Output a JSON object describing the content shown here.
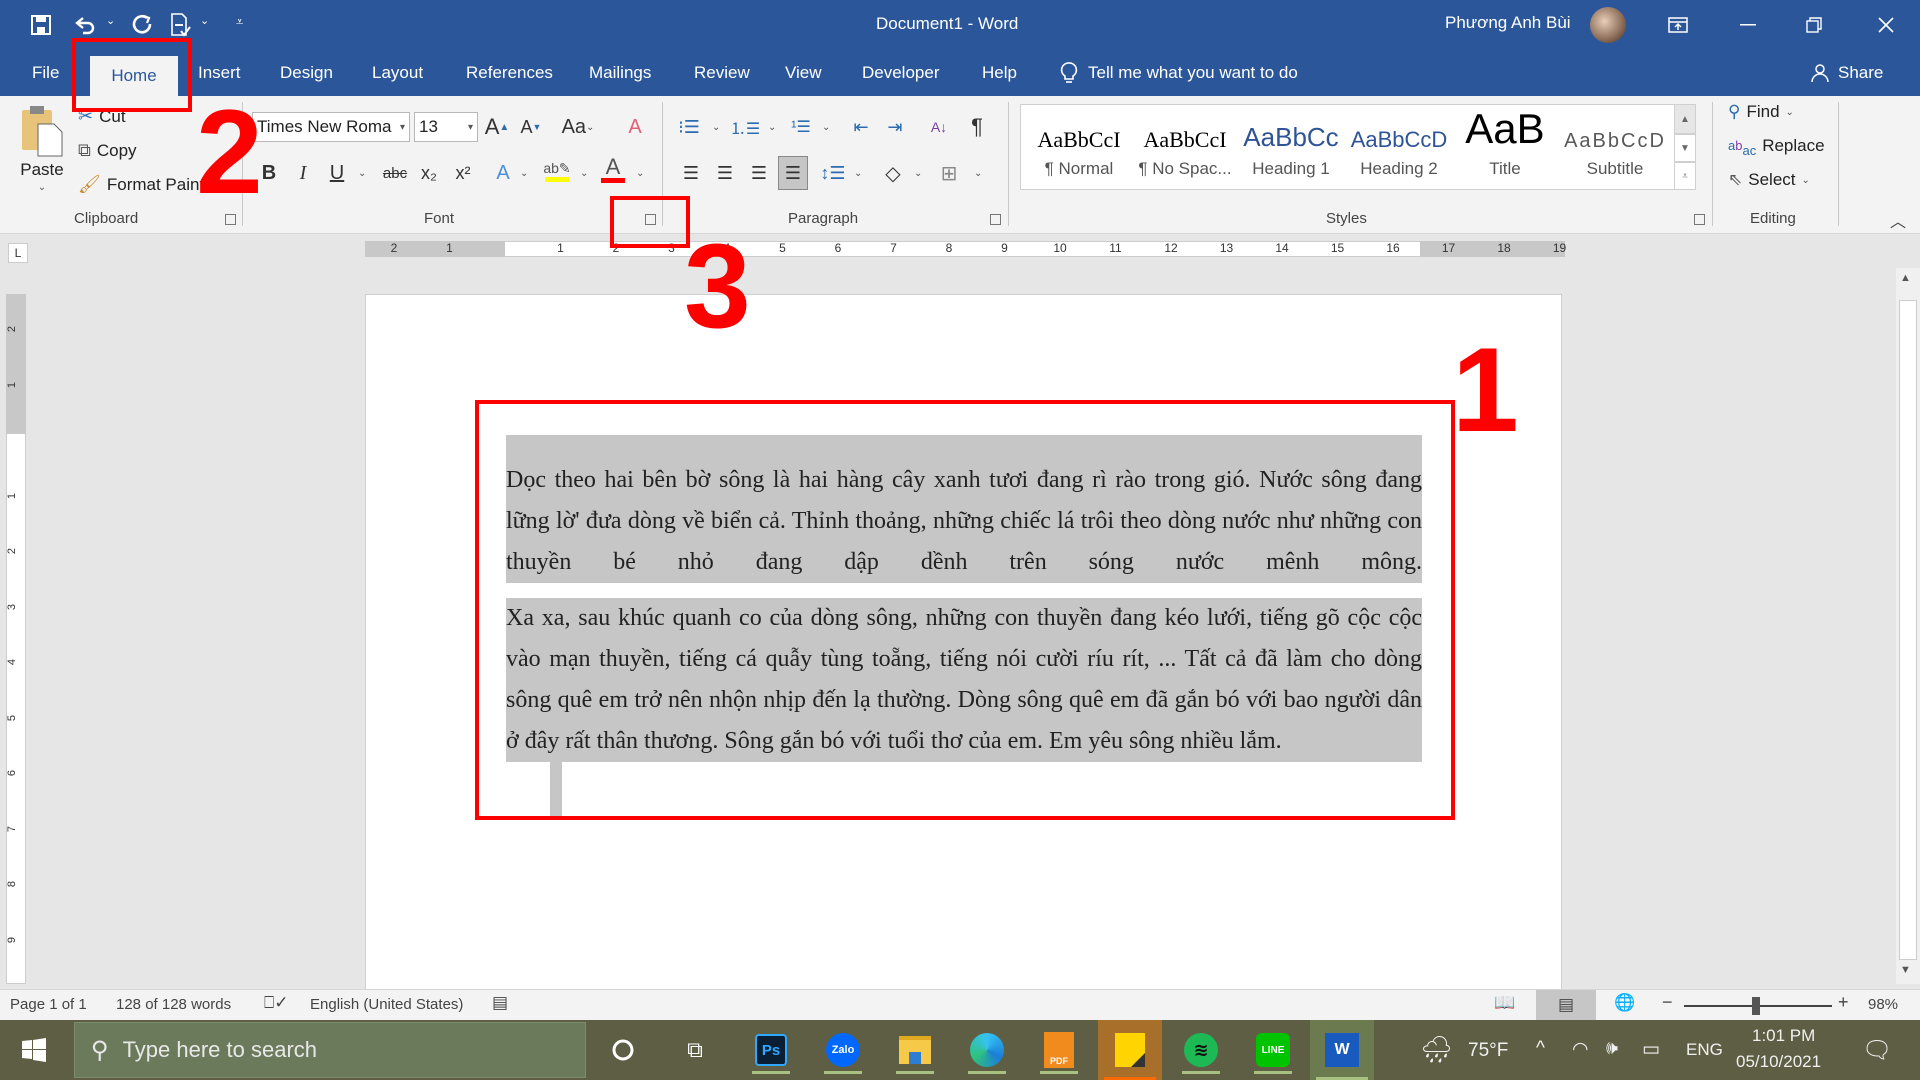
{
  "window": {
    "title": "Document1  -  Word",
    "user": "Phương Anh Bùi",
    "controls": {
      "ribbon_display": "ribbon-display-icon",
      "minimize": "minimize-icon",
      "restore": "restore-icon",
      "close": "close-icon"
    }
  },
  "qat": {
    "save": "save-icon",
    "undo": "undo-icon",
    "redo": "redo-icon",
    "touch": "touch-mode-icon",
    "customize": "customize-icon"
  },
  "tabs": [
    {
      "label": "File"
    },
    {
      "label": "Home"
    },
    {
      "label": "Insert"
    },
    {
      "label": "Design"
    },
    {
      "label": "Layout"
    },
    {
      "label": "References"
    },
    {
      "label": "Mailings"
    },
    {
      "label": "Review"
    },
    {
      "label": "View"
    },
    {
      "label": "Developer"
    },
    {
      "label": "Help"
    }
  ],
  "tell_me": "Tell me what you want to do",
  "share": "Share",
  "ribbon": {
    "clipboard": {
      "label": "Clipboard",
      "paste": "Paste",
      "cut": "Cut",
      "copy": "Copy",
      "format_painter": "Format Painter"
    },
    "font": {
      "label": "Font",
      "font_name": "Times New Roma",
      "font_size": "13",
      "change_case": "Aa",
      "bold": "B",
      "italic": "I",
      "underline": "U",
      "strike": "abc",
      "subscript": "x₂",
      "superscript": "x²",
      "highlight_color": "#ffff00",
      "font_color": "#ff0000"
    },
    "paragraph": {
      "label": "Paragraph"
    },
    "styles": {
      "label": "Styles",
      "items": [
        {
          "sample": "AaBbCcI",
          "name": "¶ Normal"
        },
        {
          "sample": "AaBbCcI",
          "name": "¶ No Spac..."
        },
        {
          "sample": "AaBbCc",
          "name": "Heading 1"
        },
        {
          "sample": "AaBbCcD",
          "name": "Heading 2"
        },
        {
          "sample": "AaB",
          "name": "Title"
        },
        {
          "sample": "AaBbCcD",
          "name": "Subtitle"
        }
      ]
    },
    "editing": {
      "label": "Editing",
      "find": "Find",
      "replace": "Replace",
      "select": "Select"
    }
  },
  "ruler": {
    "h_labels": [
      "2",
      "1",
      "1",
      "2",
      "3",
      "4",
      "5",
      "6",
      "7",
      "8",
      "9",
      "10",
      "11",
      "12",
      "13",
      "14",
      "15",
      "16",
      "17",
      "18",
      "19"
    ],
    "v_labels": [
      "2",
      "1",
      "1",
      "2",
      "3",
      "4",
      "5",
      "6",
      "7",
      "8",
      "9"
    ]
  },
  "document": {
    "paragraphs": [
      "Dọc theo hai bên bờ sông là hai hàng cây xanh tươi đang rì rào trong gió. Nước sông đang lững lờ' đưa dòng về biển cả. Thỉnh thoảng, những chiếc lá trôi theo dòng nước như những con thuyền bé nhỏ đang dập dềnh trên sóng nước mênh mông.",
      "Xa xa, sau khúc quanh co của dòng sông, những con thuyền đang kéo lưới, tiếng gõ cộc cộc vào mạn thuyền, tiếng cá quẫy tùng toẵng, tiếng nói cười ríu rít, ... Tất cả đã làm cho dòng sông quê em trở nên nhộn nhịp đến lạ thường. Dòng sông quê em đã gắn bó với bao người dân ở đây rất thân thương. Sông gắn bó với tuổi thơ của em. Em yêu sông nhiều lắm."
    ]
  },
  "annotations": {
    "one": "1",
    "two": "2",
    "three": "3",
    "color": "#ff0000"
  },
  "status": {
    "page": "Page 1 of 1",
    "words": "128 of 128 words",
    "language": "English (United States)",
    "zoom": "98%",
    "zoom_level_percent": 98
  },
  "taskbar": {
    "search_placeholder": "Type here to search",
    "apps": [
      "cortana-icon",
      "task-view-icon",
      "photoshop-icon",
      "zalo-icon",
      "file-explorer-icon",
      "edge-icon",
      "foxit-pdf-icon",
      "sticky-notes-icon",
      "spotify-icon",
      "line-icon",
      "word-icon"
    ],
    "weather": "75°F",
    "language": "ENG",
    "time": "1:01 PM",
    "date": "05/10/2021"
  }
}
